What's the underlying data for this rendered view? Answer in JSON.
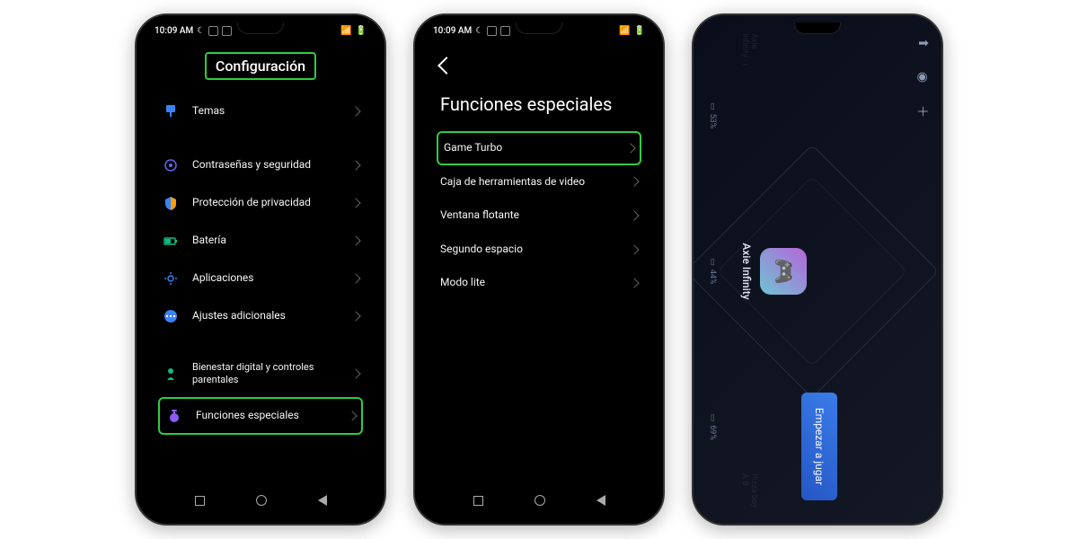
{
  "status": {
    "time": "10:09 AM",
    "signal": "▲",
    "batt": "50"
  },
  "phone1": {
    "title": "Configuración",
    "items": [
      {
        "label": "Temas",
        "icon": "themes"
      },
      {
        "label": "Contraseñas y seguridad",
        "icon": "lock"
      },
      {
        "label": "Protección de privacidad",
        "icon": "shield"
      },
      {
        "label": "Batería",
        "icon": "battery"
      },
      {
        "label": "Aplicaciones",
        "icon": "apps"
      },
      {
        "label": "Ajustes adicionales",
        "icon": "more"
      },
      {
        "label": "Bienestar digital y controles parentales",
        "icon": "wellbeing"
      },
      {
        "label": "Funciones especiales",
        "icon": "special"
      }
    ]
  },
  "phone2": {
    "title": "Funciones especiales",
    "items": [
      {
        "label": "Game Turbo"
      },
      {
        "label": "Caja de herramientas de video"
      },
      {
        "label": "Ventana flotante"
      },
      {
        "label": "Segundo espacio"
      },
      {
        "label": "Modo lite"
      }
    ]
  },
  "phone3": {
    "play_label": "Empezar a jugar",
    "center_app": "Axie Infinity",
    "left_app": "Axie Infinity - I",
    "right_app": "Pizza boy A B",
    "stats": {
      "s1": "53%",
      "s2": "44%",
      "s3": "69%"
    }
  }
}
